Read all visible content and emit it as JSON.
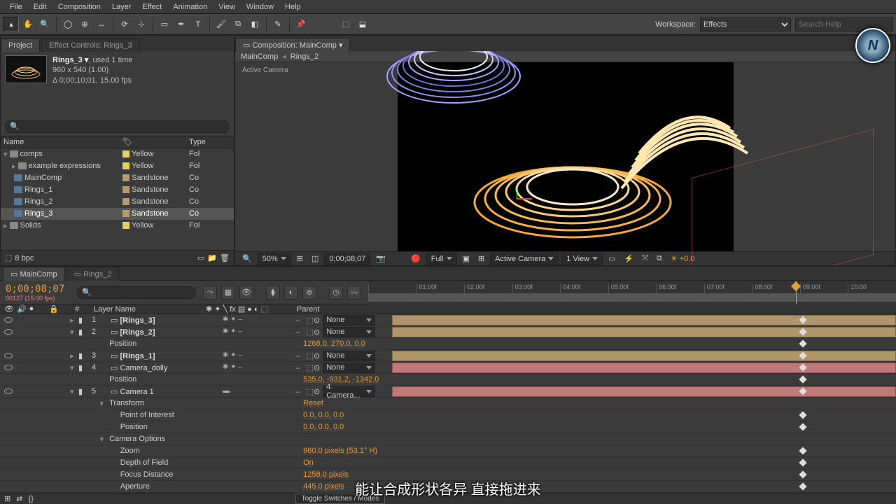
{
  "menu": {
    "items": [
      "File",
      "Edit",
      "Composition",
      "Layer",
      "Effect",
      "Animation",
      "View",
      "Window",
      "Help"
    ]
  },
  "workspace": {
    "label": "Workspace:",
    "value": "Effects",
    "search_placeholder": "Search Help"
  },
  "project_panel": {
    "tab1": "Project",
    "tab2": "Effect Controls: Rings_3",
    "item_name": "Rings_3 ▾",
    "item_used": ", used 1 time",
    "item_dims": "960 x 540 (1.00)",
    "item_dur": "Δ 0;00;10;01, 15.00 fps",
    "col_name": "Name",
    "col_type": "Type",
    "rows": [
      {
        "name": "comps",
        "icon": "folder",
        "swatch": "yellow",
        "swatch_label": "Yellow",
        "type": "Fol",
        "indent": 0,
        "tw": "▾"
      },
      {
        "name": "example expressions",
        "icon": "folder",
        "swatch": "yellow",
        "swatch_label": "Yellow",
        "type": "Fol",
        "indent": 1,
        "tw": "▸"
      },
      {
        "name": "MainComp",
        "icon": "comp",
        "swatch": "sandstone",
        "swatch_label": "Sandstone",
        "type": "Co",
        "indent": 1
      },
      {
        "name": "Rings_1",
        "icon": "comp",
        "swatch": "sandstone",
        "swatch_label": "Sandstone",
        "type": "Co",
        "indent": 1
      },
      {
        "name": "Rings_2",
        "icon": "comp",
        "swatch": "sandstone",
        "swatch_label": "Sandstone",
        "type": "Co",
        "indent": 1
      },
      {
        "name": "Rings_3",
        "icon": "comp",
        "swatch": "sandstone",
        "swatch_label": "Sandstone",
        "type": "Co",
        "indent": 1,
        "selected": true
      },
      {
        "name": "Solids",
        "icon": "folder",
        "swatch": "yellow",
        "swatch_label": "Yellow",
        "type": "Fol",
        "indent": 0,
        "tw": "▸"
      }
    ],
    "bpc": "8 bpc"
  },
  "comp_panel": {
    "tab": "Composition: MainComp",
    "crumb1": "MainComp",
    "crumb2": "Rings_2",
    "view_label": "Active Camera",
    "zoom": "50%",
    "timecode": "0;00;08;07",
    "res": "Full",
    "view3d": "Active Camera",
    "views": "1 View",
    "exposure": "+0.0"
  },
  "timeline": {
    "tab1": "MainComp",
    "tab2": "Rings_2",
    "timecode": "0;00;08;07",
    "subframe": "00127 (15.00 fps)",
    "col_num": "#",
    "col_name": "Layer Name",
    "col_parent": "Parent",
    "ruler": [
      "01:00f",
      "02:00f",
      "03:00f",
      "04:00f",
      "05:00f",
      "06:00f",
      "07:00f",
      "08:00f",
      "09:00f",
      "10:00"
    ],
    "layers": [
      {
        "num": 1,
        "name": "[Rings_3]",
        "chip": "tan",
        "parent": "None",
        "tw": "▸",
        "bracket": true
      },
      {
        "num": 2,
        "name": "[Rings_2]",
        "chip": "tan",
        "parent": "None",
        "tw": "▾",
        "bracket": true,
        "props": [
          {
            "name": "Position",
            "val": "1268.0, 270.0, 0.0",
            "stop": true
          }
        ]
      },
      {
        "num": 3,
        "name": "[Rings_1]",
        "chip": "tan",
        "parent": "None",
        "tw": "▸",
        "bracket": true
      },
      {
        "num": 4,
        "name": "Camera_dolly",
        "chip": "red",
        "parent": "None",
        "tw": "▾",
        "props": [
          {
            "name": "Position",
            "val": "535.0, -931.2, -1342.0",
            "stop": true
          }
        ]
      },
      {
        "num": 5,
        "name": "Camera 1",
        "chip": "red",
        "parent": "4. Camera...",
        "tw": "▾",
        "camera": true,
        "groups": [
          {
            "name": "Transform",
            "val": "Reset",
            "tw": "▾"
          },
          {
            "name": "Point of Interest",
            "val": "0.0, 0.0, 0.0",
            "stop": true,
            "sub": true
          },
          {
            "name": "Position",
            "val": "0.0, 0.0, 0.0",
            "stop": true,
            "sub": true
          },
          {
            "name": "Camera Options",
            "tw": "▾"
          },
          {
            "name": "Zoom",
            "val": "960.0 pixels (53.1° H)",
            "stop": true,
            "sub": true
          },
          {
            "name": "Depth of Field",
            "val": "On",
            "stop": true,
            "sub": true
          },
          {
            "name": "Focus Distance",
            "val": "1258.0 pixels",
            "stop": true,
            "sub": true
          },
          {
            "name": "Aperture",
            "val": "445.0 pixels",
            "stop": true,
            "sub": true
          }
        ]
      }
    ],
    "toggle": "Toggle Switches / Modes"
  },
  "subtitle": "能让合成形状各异 直接拖进来"
}
